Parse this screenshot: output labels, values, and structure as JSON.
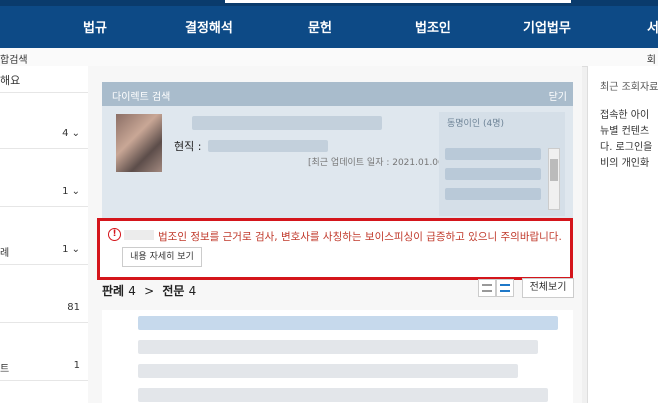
{
  "nav": {
    "items": [
      "법규",
      "결정해석",
      "문헌",
      "법조인",
      "기업법무",
      "서"
    ]
  },
  "subbar": {
    "breadcrumb": "합검색",
    "right_label": "회"
  },
  "sidebar": {
    "header": "해요",
    "items": [
      {
        "label": "",
        "count": "4 ⌄"
      },
      {
        "label": "",
        "count": "1 ⌄"
      },
      {
        "label": "례",
        "count": "1 ⌄"
      },
      {
        "label": "",
        "count": "81"
      },
      {
        "label": "트",
        "count": "1"
      }
    ]
  },
  "direct_search": {
    "title": "다이렉트 검색",
    "close_label": "닫기",
    "job_label": "현직 :",
    "updated": "[최근 업데이트 일자 : 2021.01.06]",
    "colleagues_label": "동명이인 (4명)"
  },
  "warning": {
    "icon": "info-icon",
    "message": "법조인 정보를 근거로 검사, 변호사를 사칭하는 보이스피싱이 급증하고 있으니 주의바랍니다.",
    "button_label": "내용 자세히 보기"
  },
  "tabs": {
    "first_label": "판례",
    "first_count": "4",
    "separator": ">",
    "second_label": "전문",
    "second_count": "4"
  },
  "toolbar": {
    "all_view_label": "전체보기"
  },
  "recent": {
    "title": "최근 조회자료",
    "lines": [
      "접속한 아이",
      "뉴별 컨텐츠",
      "다. 로그인을",
      "비의 개인화"
    ]
  },
  "colors": {
    "nav_bg": "#0d4a86",
    "warning_border": "#d4151b",
    "warning_text": "#c0392b",
    "panel_head": "#a9bccc"
  }
}
